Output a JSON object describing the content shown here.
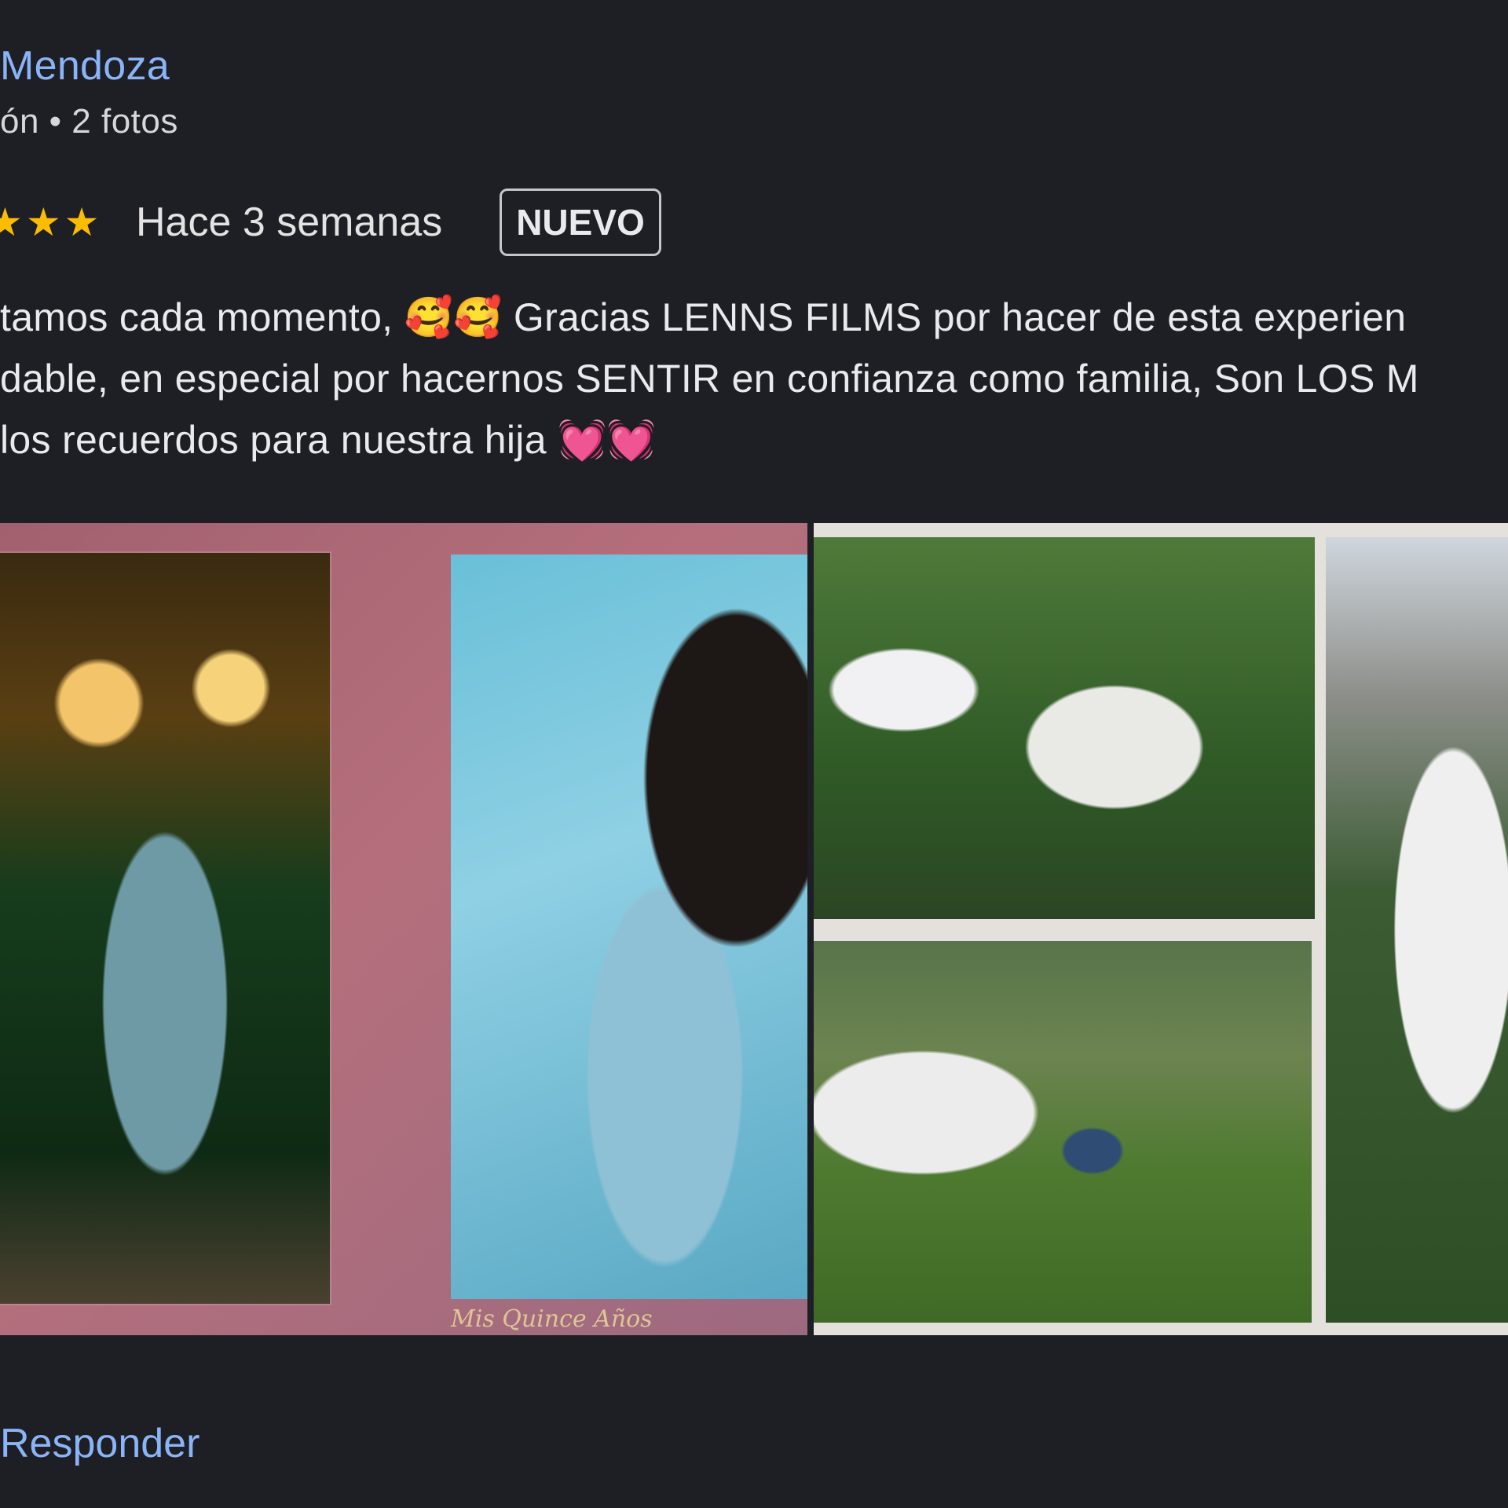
{
  "author": {
    "name": "Mendoza",
    "meta": "ón • 2 fotos"
  },
  "rating": {
    "stars_text": "★★★",
    "time": "Hace 3 semanas",
    "badge": "NUEVO"
  },
  "review": {
    "lines": [
      "tamos cada momento, 🥰🥰 Gracias LENNS FILMS por hacer de esta experien",
      "dable, en especial por hacernos SENTIR en confianza como familia, Son LOS M",
      "los recuerdos para nuestra hija 💓💓"
    ]
  },
  "photos": {
    "photo1_signature": "Mis Quince Años"
  },
  "actions": {
    "reply": "Responder"
  },
  "colors": {
    "link": "#8ab4f8",
    "star": "#fbbc04",
    "background": "#1e1f24"
  }
}
